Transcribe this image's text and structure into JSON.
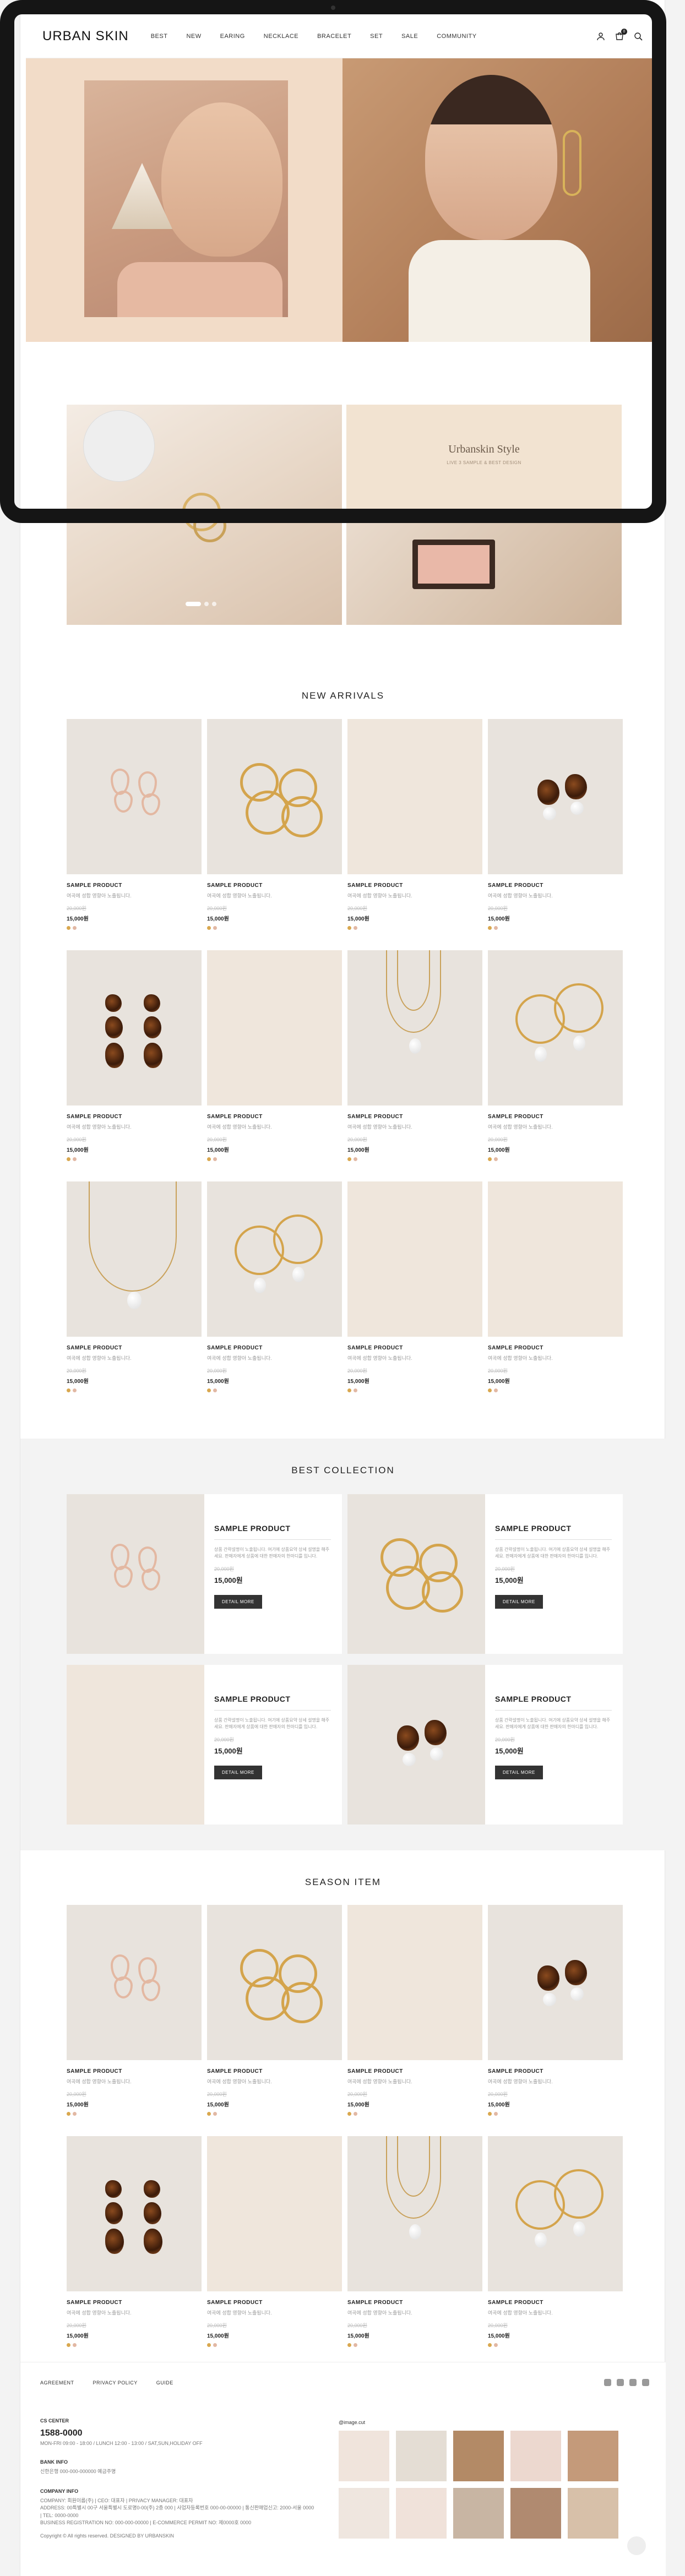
{
  "brand": {
    "logo": "URBAN SKIN"
  },
  "nav": [
    "BEST",
    "NEW",
    "EARING",
    "NECKLACE",
    "BRACELET",
    "SET",
    "SALE",
    "COMMUNITY"
  ],
  "header_icons": [
    "user-icon",
    "cart-icon",
    "search-icon"
  ],
  "cart": {
    "count": "0"
  },
  "promo": {
    "title": "Urbanskin Style",
    "subtitle": "LIVE 3 SAMPLE & BEST DESIGN"
  },
  "sections": {
    "new_arrivals": "NEW ARRIVALS",
    "best_collection": "BEST COLLECTION",
    "season_item": "SEASON ITEM"
  },
  "product": {
    "name": "SAMPLE PRODUCT",
    "desc": "여곡에 성합 영향아 노출됩니다.",
    "old_price": "20,000원",
    "price": "15,000원"
  },
  "best_product": {
    "name": "SAMPLE PRODUCT",
    "desc": "상품 간략설명이 노출됩니다. 여기에 상품요약 상세 설명을 해주세요. 판매자에게 상품에 대한 판매자의 한마디를 입니다.",
    "old_price": "20,000원",
    "price": "15,000원",
    "button": "DETAIL MORE"
  },
  "swatch_colors": [
    "#d9a84f",
    "#e2b8a4"
  ],
  "footer": {
    "links": [
      "AGREEMENT",
      "PRIVACY POLICY",
      "GUIDE"
    ],
    "cs_label": "CS CENTER",
    "cs_phone": "1588-0000",
    "cs_hours": "MON-FRI 09:00 - 18:00 / LUNCH 12:00 - 13:00 / SAT,SUN,HOLIDAY OFF",
    "bank_label": "BANK INFO",
    "bank_text": "신한은행 000-000-000000 예금주명",
    "company_label": "COMPANY INFO",
    "company_lines": [
      "COMPANY: 회원이름(주) | CEO: 대표자 | PRIVACY MANAGER: 대표자",
      "ADDRESS: 00특별시 00구 서울특별시 도로명0-00(주) 2층 000 | 사업자등록번호 000-00-00000 | 통신판매업신고: 2000-서울 0000 | TEL: 0000-0000",
      "BUSINESS REGISTRATION NO: 000-000-00000 | E-COMMERCE PERMIT NO: 제0000호 0000"
    ],
    "copyright": "Copyright © All rights reserved. DESIGNED BY URBANSKIN",
    "insta_title": "@image.cut"
  }
}
